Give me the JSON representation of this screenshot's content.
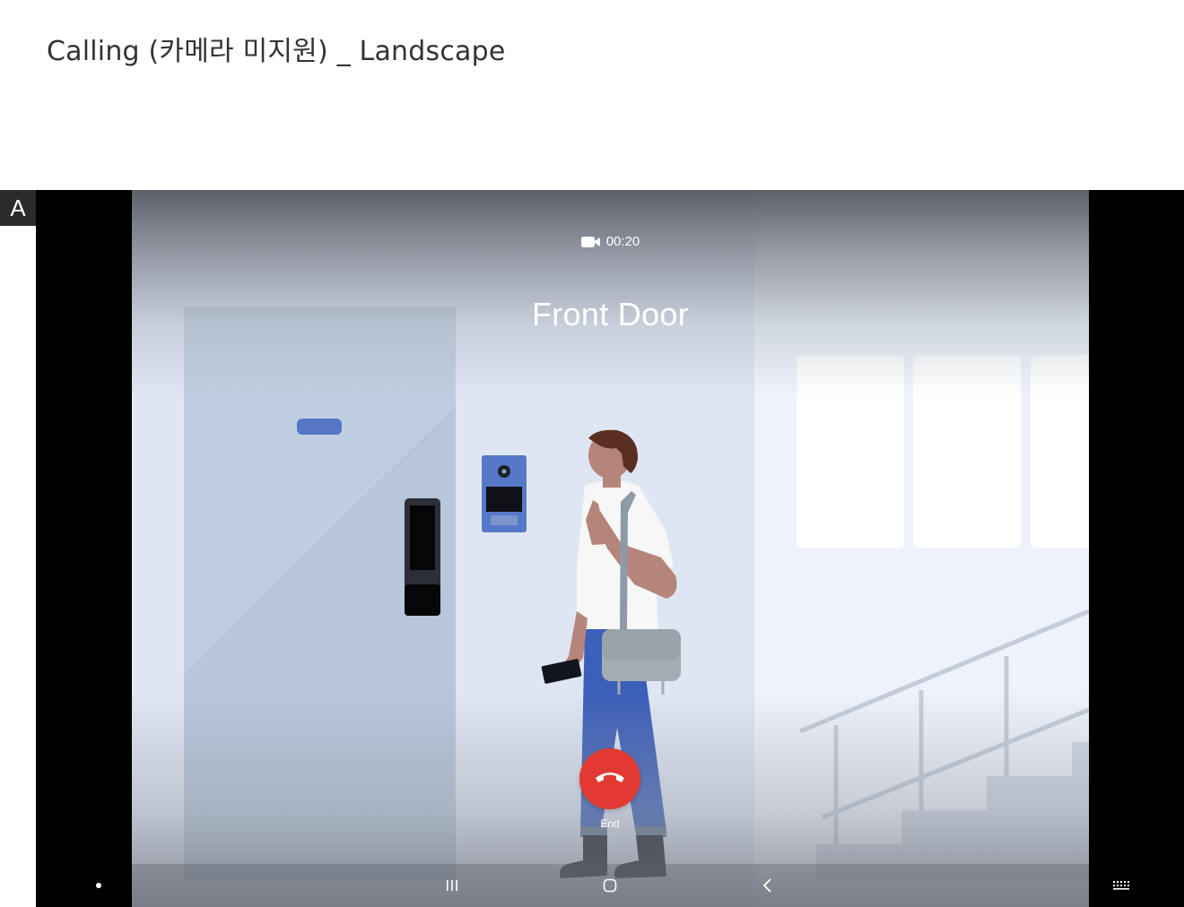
{
  "page": {
    "title": "Calling (카메라 미지원) _  Landscape",
    "variant_label": "A"
  },
  "call": {
    "duration": "00:20",
    "caller_name": "Front Door",
    "end_label": "End",
    "end_color": "#e23a33"
  },
  "nav_bar": {
    "items": [
      "recent-apps-icon",
      "home-icon",
      "back-icon",
      "keyboard-icon"
    ]
  },
  "icons": {
    "video": "video-camera-icon",
    "end": "phone-hangup-icon"
  }
}
